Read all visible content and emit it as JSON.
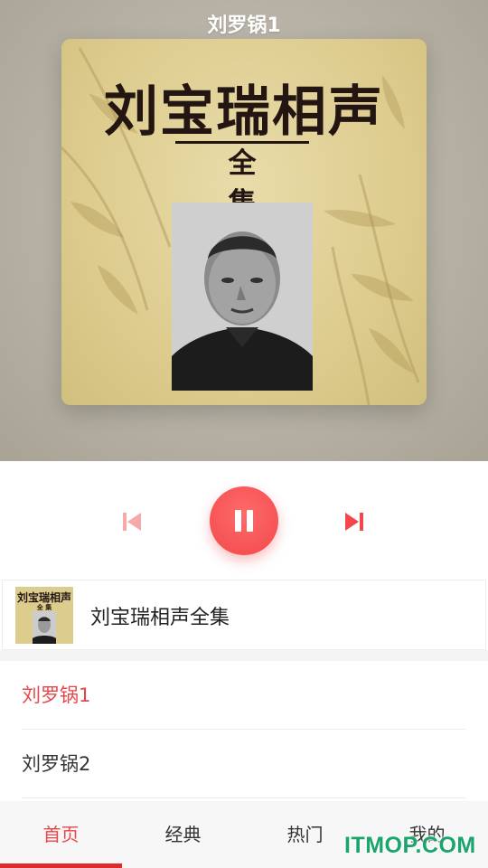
{
  "header": {
    "title": "刘罗锅1"
  },
  "cover": {
    "title": "刘宝瑞相声",
    "subtitle": "全 集"
  },
  "player": {
    "prev_icon": "skip-previous-icon",
    "play_state_icon": "pause-icon",
    "next_icon": "skip-next-icon",
    "accent": "#f2484b"
  },
  "album": {
    "name": "刘宝瑞相声全集",
    "thumb_title": "刘宝瑞相声",
    "thumb_sub": "全 集"
  },
  "tracks": [
    {
      "title": "刘罗锅1",
      "active": true
    },
    {
      "title": "刘罗锅2",
      "active": false
    }
  ],
  "tabs": [
    {
      "label": "首页",
      "active": true
    },
    {
      "label": "经典",
      "active": false
    },
    {
      "label": "热门",
      "active": false
    },
    {
      "label": "我的",
      "active": false
    }
  ],
  "watermark": "ITMOP.COM"
}
